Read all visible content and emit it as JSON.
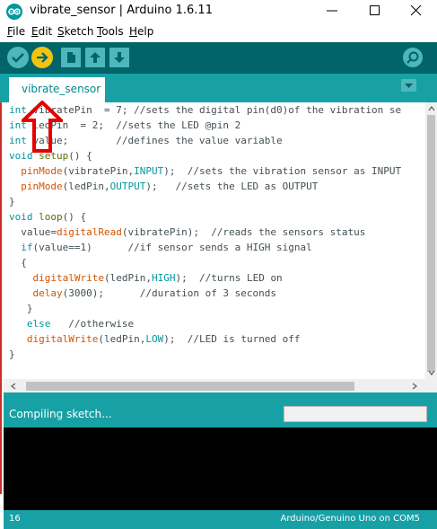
{
  "window": {
    "title": "vibrate_sensor | Arduino 1.6.11"
  },
  "menu": [
    "File",
    "Edit",
    "Sketch",
    "Tools",
    "Help"
  ],
  "toolbar": {
    "verify": "verify-icon",
    "upload": "upload-icon",
    "new": "new-icon",
    "open": "open-icon",
    "save": "save-icon",
    "serial_monitor": "serial-monitor-icon"
  },
  "tabs": [
    {
      "label": "vibrate_sensor"
    }
  ],
  "code": [
    "int vibratePin  = 7; //sets the digital pin(d0)of the vibration se",
    "int ledPin  = 2;  //sets the LED @pin 2",
    "int value;        //defines the value variable",
    "void setup() {",
    "  pinMode(vibratePin,INPUT);  //sets the vibration sensor as INPUT",
    "  pinMode(ledPin,OUTPUT);   //sets the LED as OUTPUT",
    "}",
    "void loop() {",
    "  value=digitalRead(vibratePin);  //reads the sensors status",
    "  if(value==1)      //if sensor sends a HIGH signal",
    "  {",
    "    digitalWrite(ledPin,HIGH);  //turns LED on",
    "    delay(3000);      //duration of 3 seconds",
    "   }",
    "   else   //otherwise",
    "   digitalWrite(ledPin,LOW);  //LED is turned off",
    "}"
  ],
  "status": {
    "message": "Compiling sketch...",
    "progress": 0.0
  },
  "footer": {
    "line": "16",
    "board": "Arduino/Genuino Uno on COM5"
  },
  "colors": {
    "toolbar": "#006468",
    "tabbar": "#17a1a5",
    "keyword": "#00979c",
    "function": "#d35400",
    "annotation": "#e60000"
  }
}
